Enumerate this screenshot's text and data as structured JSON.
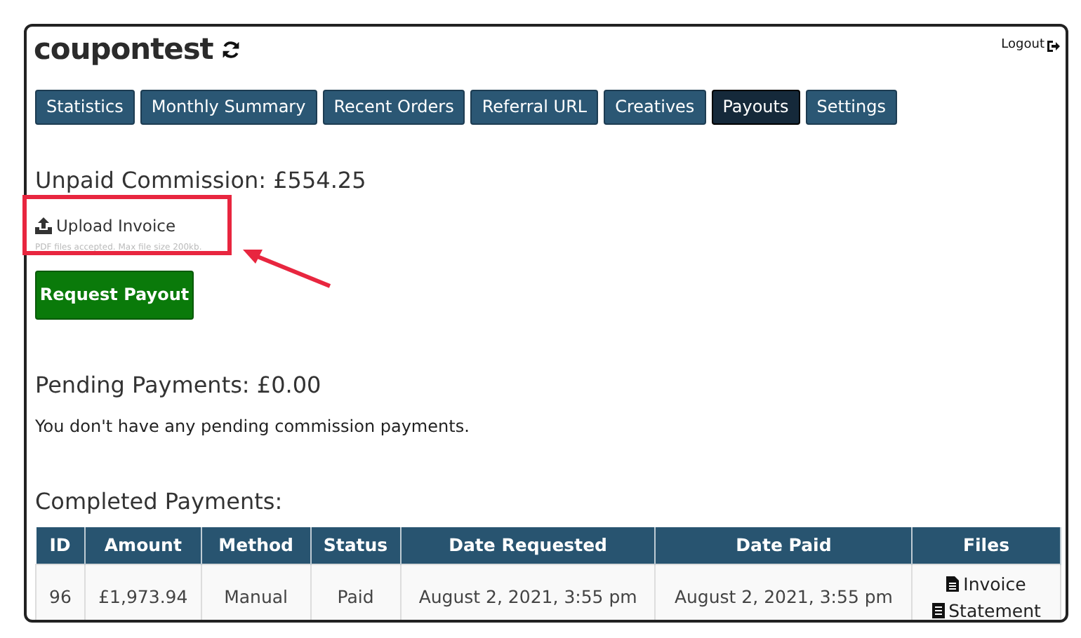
{
  "header": {
    "title": "coupontest",
    "logout": "Logout"
  },
  "tabs": [
    {
      "label": "Statistics",
      "selected": false
    },
    {
      "label": "Monthly Summary",
      "selected": false
    },
    {
      "label": "Recent Orders",
      "selected": false
    },
    {
      "label": "Referral URL",
      "selected": false
    },
    {
      "label": "Creatives",
      "selected": false
    },
    {
      "label": "Payouts",
      "selected": true
    },
    {
      "label": "Settings",
      "selected": false
    }
  ],
  "unpaid": {
    "heading": "Unpaid Commission: £554.25",
    "upload_label": "Upload Invoice",
    "upload_hint": "PDF files accepted. Max file size 200kb.",
    "button": "Request Payout"
  },
  "pending": {
    "heading": "Pending Payments: £0.00",
    "message": "You don't have any pending commission payments."
  },
  "completed": {
    "heading": "Completed Payments:",
    "columns": [
      "ID",
      "Amount",
      "Method",
      "Status",
      "Date Requested",
      "Date Paid",
      "Files"
    ],
    "rows": [
      {
        "cells": [
          "96",
          "£1,973.94",
          "Manual",
          "Paid",
          "August 2, 2021, 3:55 pm",
          "August 2, 2021, 3:55 pm"
        ],
        "files": [
          {
            "kind": "invoice",
            "label": "Invoice"
          },
          {
            "kind": "statement",
            "label": "Statement"
          }
        ]
      }
    ]
  }
}
